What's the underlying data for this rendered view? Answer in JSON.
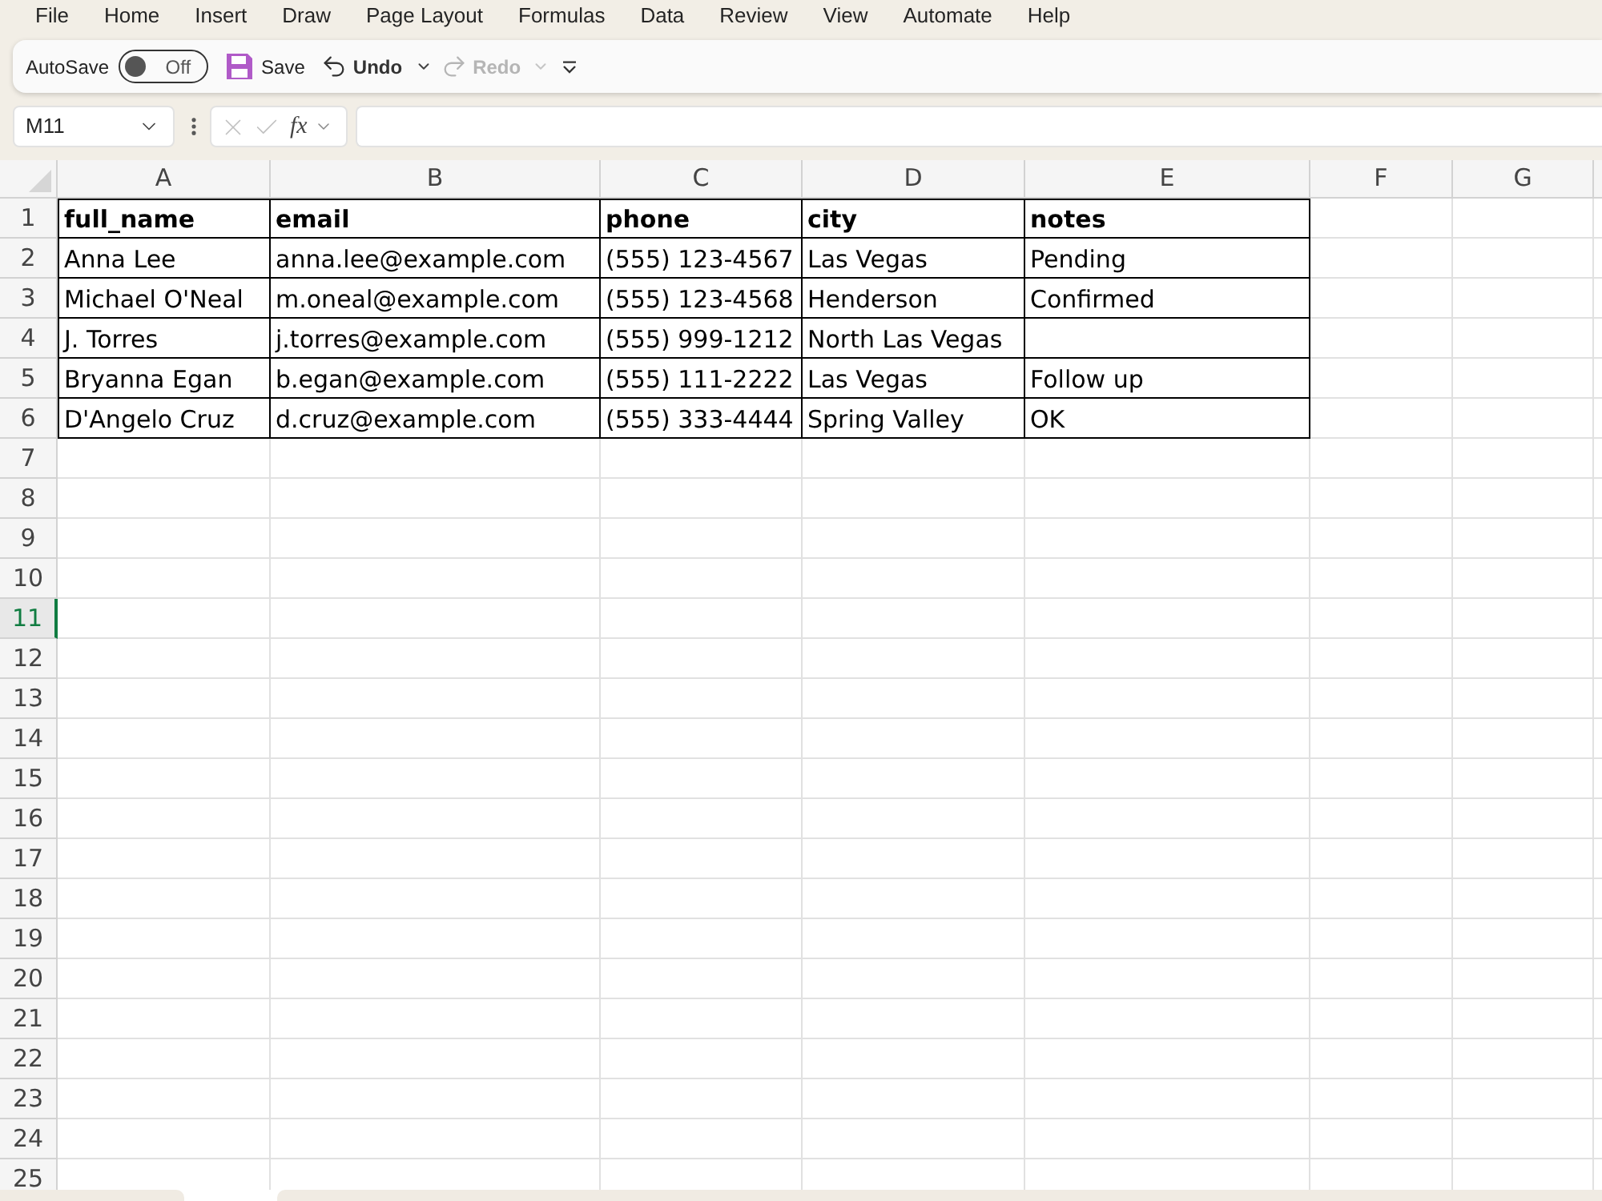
{
  "menu": [
    "File",
    "Home",
    "Insert",
    "Draw",
    "Page Layout",
    "Formulas",
    "Data",
    "Review",
    "View",
    "Automate",
    "Help"
  ],
  "toolbar": {
    "autosave": {
      "label": "AutoSave",
      "on": false,
      "state_text": "Off"
    },
    "save": {
      "label": "Save"
    },
    "undo": {
      "label": "Undo",
      "disabled": false
    },
    "redo": {
      "label": "Redo",
      "disabled": true
    }
  },
  "formula_bar": {
    "name_box": "M11",
    "function_label": "fx"
  },
  "sheet": {
    "columns": [
      {
        "label": "A",
        "selected": false
      },
      {
        "label": "B",
        "selected": false
      },
      {
        "label": "C",
        "selected": false
      },
      {
        "label": "D",
        "selected": false
      },
      {
        "label": "E",
        "selected": false
      },
      {
        "label": "F",
        "selected": false
      },
      {
        "label": "G",
        "selected": false
      }
    ],
    "rows": [
      {
        "label": "1",
        "selected": false
      },
      {
        "label": "2",
        "selected": false
      },
      {
        "label": "3",
        "selected": false
      },
      {
        "label": "4",
        "selected": false
      },
      {
        "label": "5",
        "selected": false
      },
      {
        "label": "6",
        "selected": false
      },
      {
        "label": "7",
        "selected": false
      },
      {
        "label": "8",
        "selected": false
      },
      {
        "label": "9",
        "selected": false
      },
      {
        "label": "10",
        "selected": false
      },
      {
        "label": "11",
        "selected": true
      },
      {
        "label": "12",
        "selected": false
      },
      {
        "label": "13",
        "selected": false
      },
      {
        "label": "14",
        "selected": false
      },
      {
        "label": "15",
        "selected": false
      },
      {
        "label": "16",
        "selected": false
      },
      {
        "label": "17",
        "selected": false
      },
      {
        "label": "18",
        "selected": false
      },
      {
        "label": "19",
        "selected": false
      },
      {
        "label": "20",
        "selected": false
      },
      {
        "label": "21",
        "selected": false
      },
      {
        "label": "22",
        "selected": false
      },
      {
        "label": "23",
        "selected": false
      },
      {
        "label": "24",
        "selected": false
      },
      {
        "label": "25",
        "selected": false
      }
    ],
    "table": {
      "header": [
        "full_name",
        "email",
        "phone",
        "city",
        "notes"
      ],
      "rows": [
        [
          "Anna Lee",
          "anna.lee@example.com",
          "(555) 123-4567",
          "Las Vegas",
          "Pending"
        ],
        [
          "Michael O'Neal",
          "m.oneal@example.com",
          "(555) 123-4568",
          "Henderson",
          "Confirmed"
        ],
        [
          "J. Torres",
          "j.torres@example.com",
          "(555) 999-1212",
          "North Las Vegas"
        ],
        [
          "Bryanna Egan",
          "b.egan@example.com",
          "(555) 111-2222",
          "Las Vegas",
          "Follow up"
        ],
        [
          "D'Angelo Cruz",
          "d.cruz@example.com",
          "(555) 333-4444",
          "Spring Valley",
          "OK"
        ]
      ]
    }
  }
}
